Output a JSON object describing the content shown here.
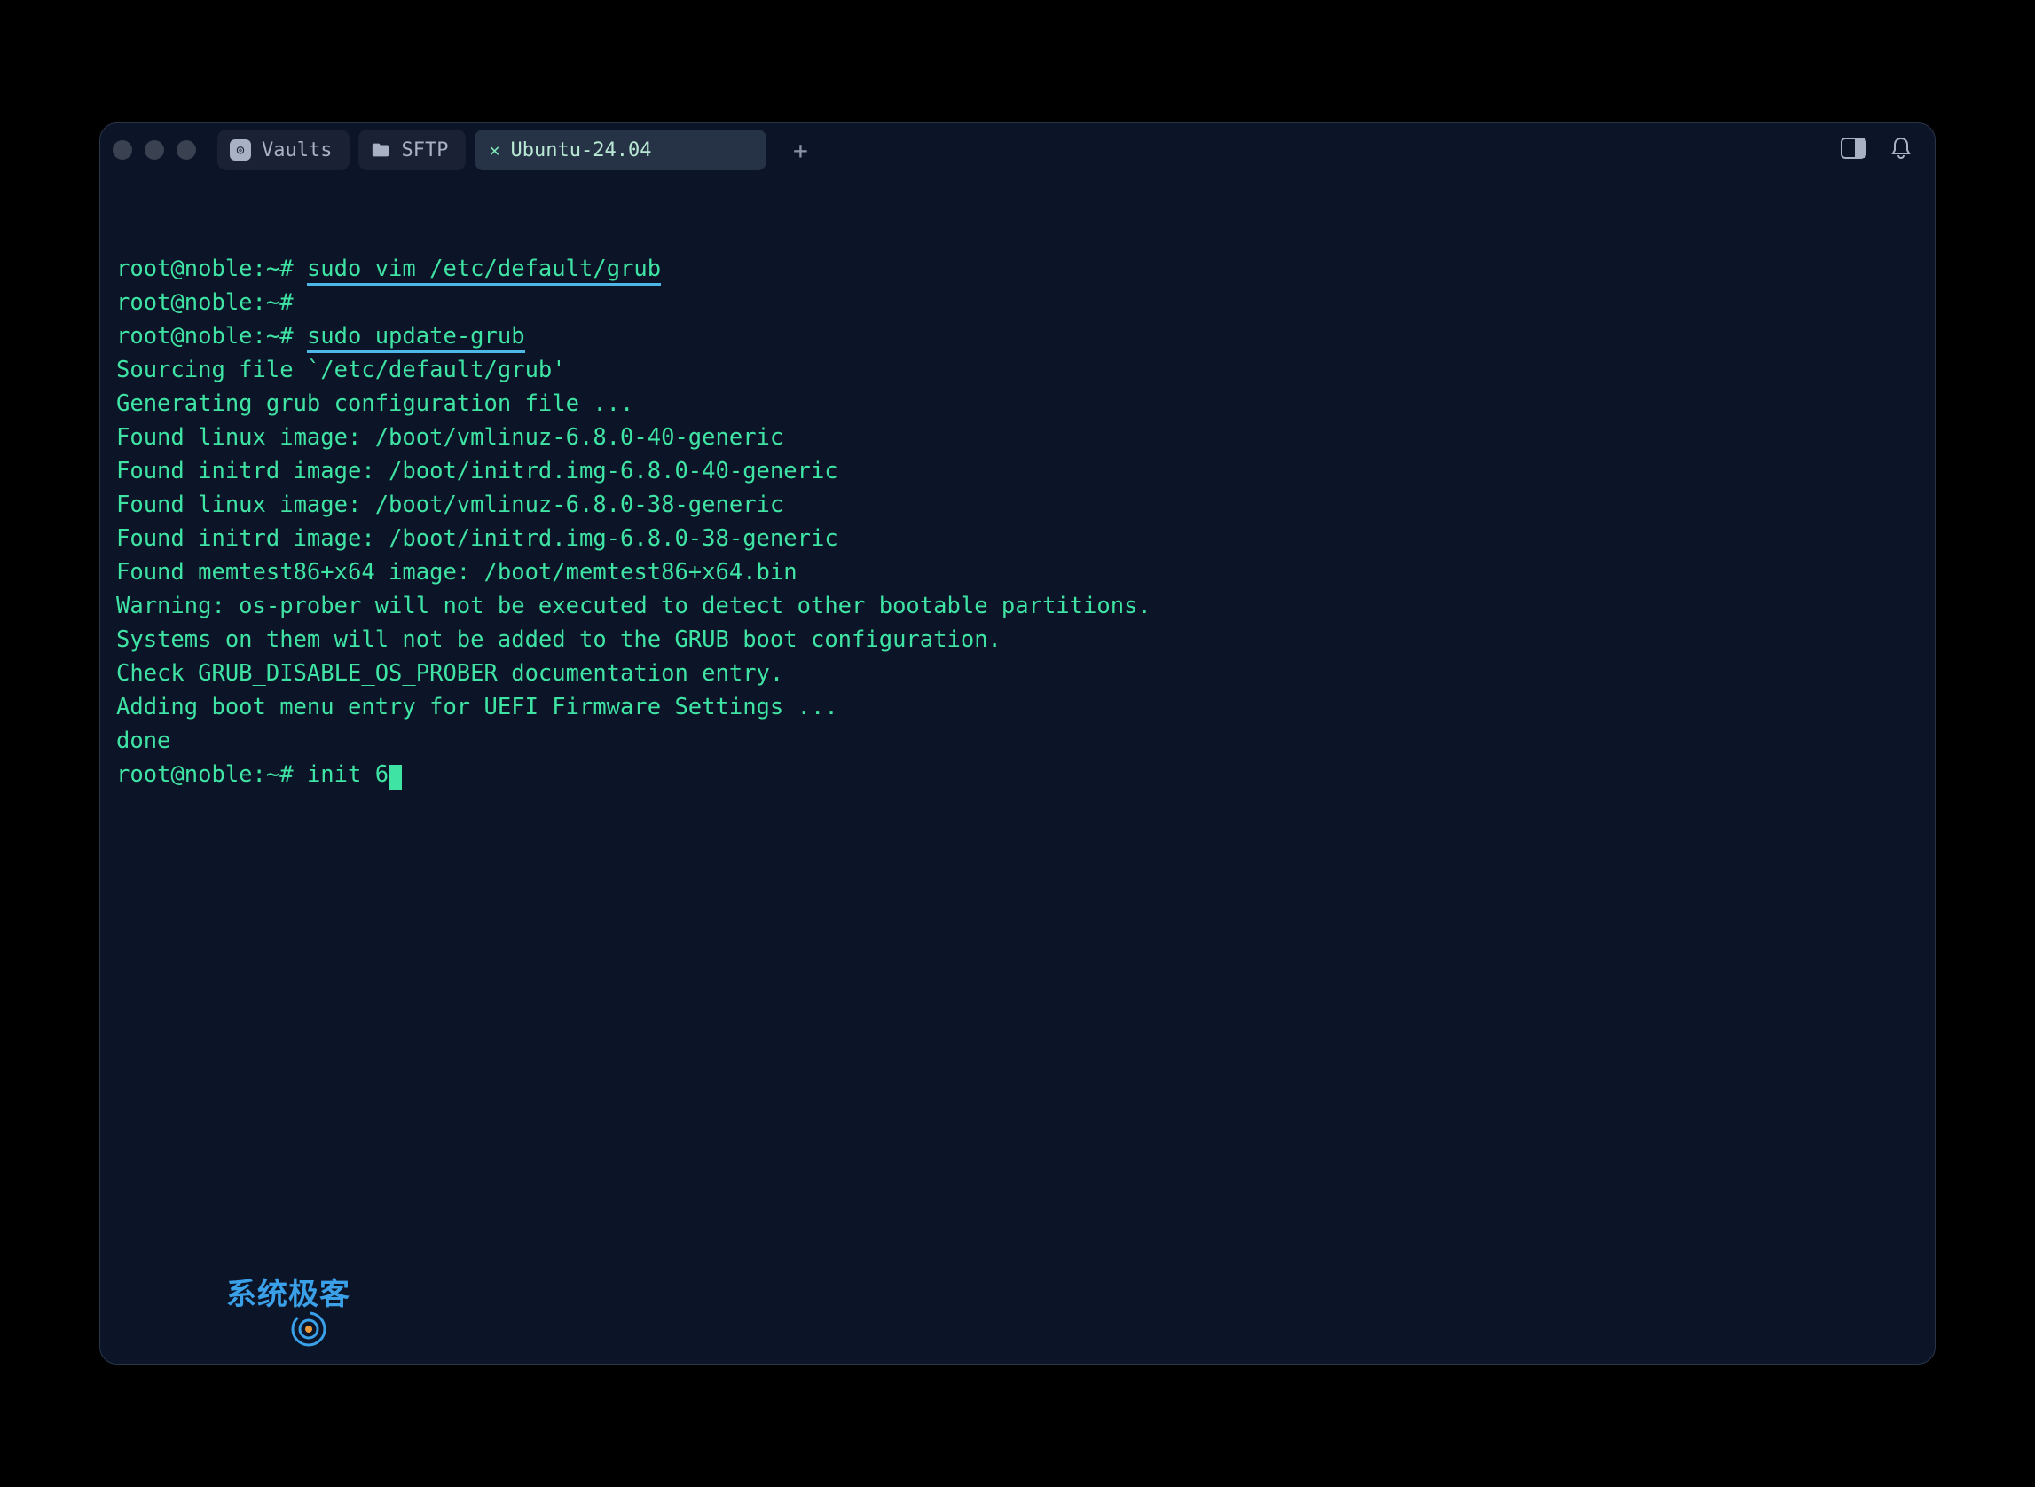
{
  "tabs": {
    "vaults": "Vaults",
    "sftp": "SFTP",
    "ubuntu": "Ubuntu-24.04"
  },
  "terminal": {
    "prompt": "root@noble:~# ",
    "lines": [
      {
        "prompt": true,
        "cmd": "sudo vim /etc/default/grub",
        "underline": true
      },
      {
        "prompt": true,
        "cmd": ""
      },
      {
        "prompt": true,
        "cmd": "sudo update-grub",
        "underline": true
      },
      {
        "text": "Sourcing file `/etc/default/grub'"
      },
      {
        "text": "Generating grub configuration file ..."
      },
      {
        "text": "Found linux image: /boot/vmlinuz-6.8.0-40-generic"
      },
      {
        "text": "Found initrd image: /boot/initrd.img-6.8.0-40-generic"
      },
      {
        "text": "Found linux image: /boot/vmlinuz-6.8.0-38-generic"
      },
      {
        "text": "Found initrd image: /boot/initrd.img-6.8.0-38-generic"
      },
      {
        "text": "Found memtest86+x64 image: /boot/memtest86+x64.bin"
      },
      {
        "text": "Warning: os-prober will not be executed to detect other bootable partitions."
      },
      {
        "text": "Systems on them will not be added to the GRUB boot configuration."
      },
      {
        "text": "Check GRUB_DISABLE_OS_PROBER documentation entry."
      },
      {
        "text": "Adding boot menu entry for UEFI Firmware Settings ..."
      },
      {
        "text": "done"
      },
      {
        "prompt": true,
        "cmd": "init 6",
        "cursor": true
      }
    ]
  },
  "watermark": "系统极客"
}
